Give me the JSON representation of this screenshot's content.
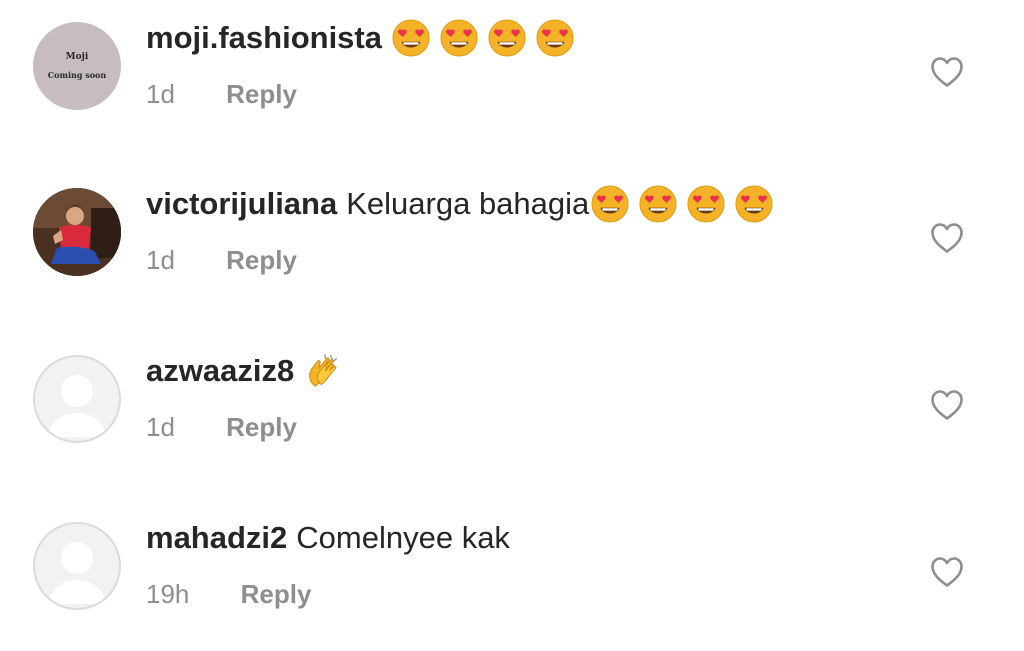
{
  "comments": [
    {
      "username": "moji.fashionista",
      "text": "",
      "emojis": [
        "heart-eyes-emoji",
        "heart-eyes-emoji",
        "heart-eyes-emoji",
        "heart-eyes-emoji"
      ],
      "time": "1d",
      "reply_label": "Reply",
      "avatar": {
        "type": "brand",
        "name": "Moji",
        "subtitle": "Coming soon"
      }
    },
    {
      "username": "victorijuliana",
      "text": "Keluarga bahagia",
      "emojis": [
        "heart-eyes-emoji",
        "heart-eyes-emoji",
        "heart-eyes-emoji",
        "heart-eyes-emoji"
      ],
      "time": "1d",
      "reply_label": "Reply",
      "avatar": {
        "type": "photo"
      }
    },
    {
      "username": "azwaaziz8",
      "text": "",
      "emojis": [
        "clapping-hands-emoji"
      ],
      "time": "1d",
      "reply_label": "Reply",
      "avatar": {
        "type": "default"
      }
    },
    {
      "username": "mahadzi2",
      "text": "Comelnyee kak",
      "emojis": [],
      "time": "19h",
      "reply_label": "Reply",
      "avatar": {
        "type": "default"
      }
    }
  ],
  "icons": {
    "like": "heart-outline-icon",
    "default_avatar": "person-silhouette-icon"
  },
  "colors": {
    "background": "#ffffff",
    "primary_text": "#262626",
    "secondary_text": "#8e8e8e",
    "emoji_face": "#f4b226",
    "emoji_heart": "#e8334a"
  }
}
